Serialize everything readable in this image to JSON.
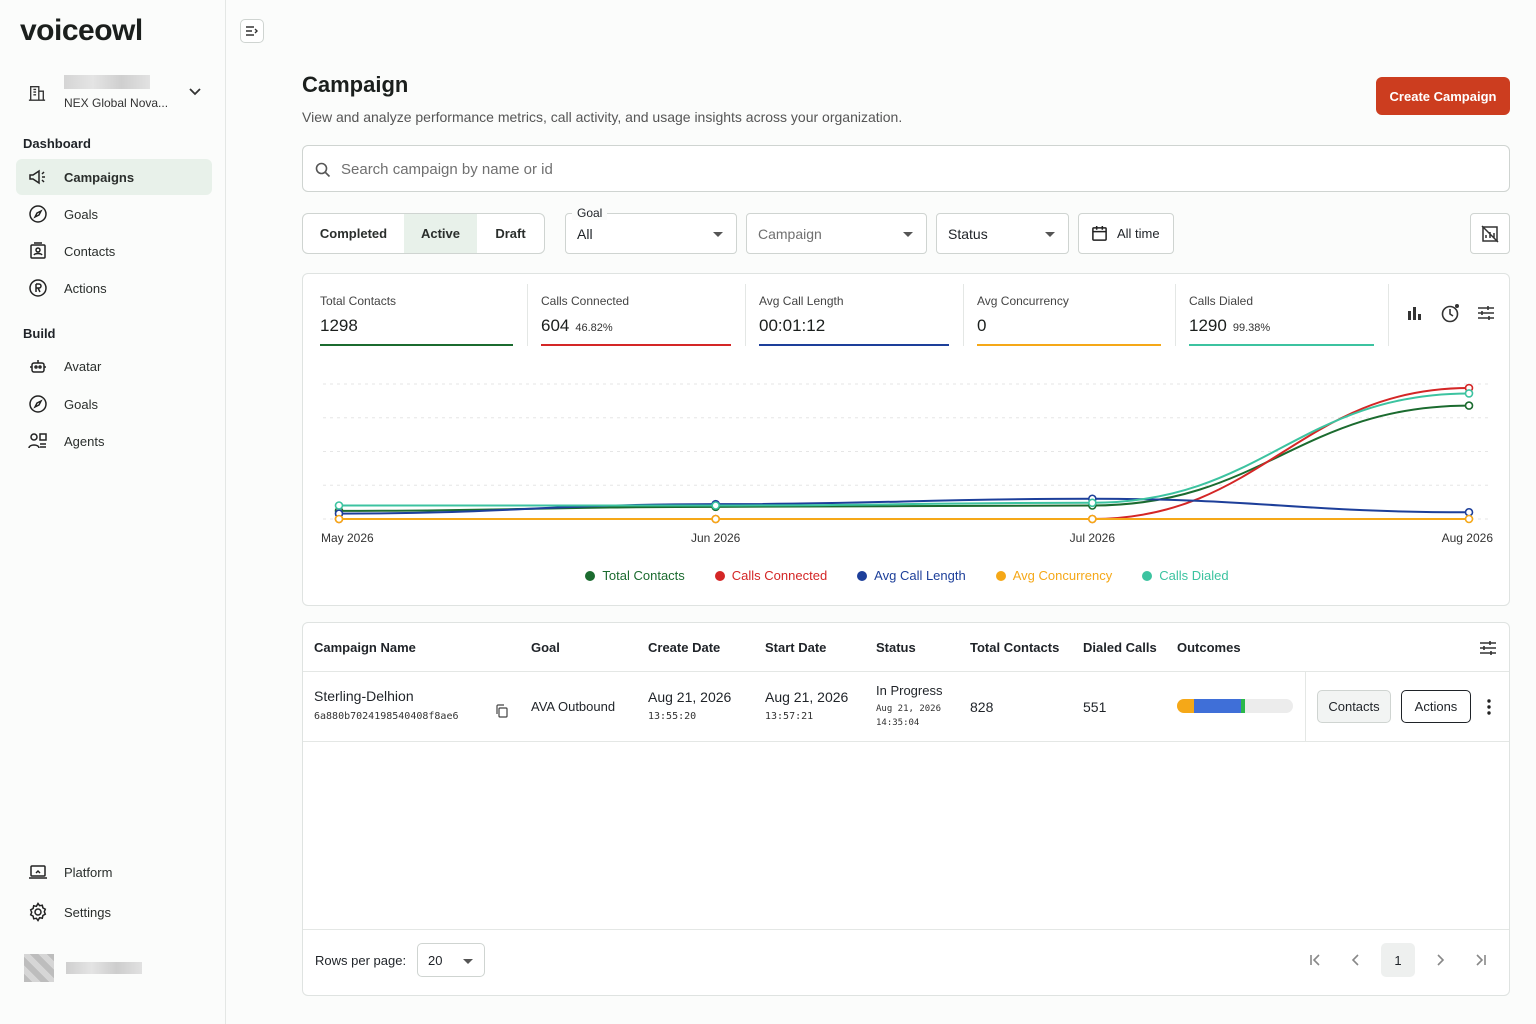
{
  "app": {
    "logo": "voiceowl"
  },
  "org": {
    "name": "NEX Global Nova..."
  },
  "sidebar": {
    "dashboard_title": "Dashboard",
    "dashboard_items": [
      {
        "label": "Campaigns",
        "icon": "megaphone-icon",
        "active": true
      },
      {
        "label": "Goals",
        "icon": "compass-icon"
      },
      {
        "label": "Contacts",
        "icon": "contacts-icon"
      },
      {
        "label": "Actions",
        "icon": "actions-icon"
      }
    ],
    "build_title": "Build",
    "build_items": [
      {
        "label": "Avatar",
        "icon": "robot-icon"
      },
      {
        "label": "Goals",
        "icon": "compass-icon"
      },
      {
        "label": "Agents",
        "icon": "agents-icon"
      }
    ],
    "bottom_items": [
      {
        "label": "Platform",
        "icon": "laptop-icon"
      },
      {
        "label": "Settings",
        "icon": "gear-icon"
      }
    ]
  },
  "header": {
    "title": "Campaign",
    "subtitle": "View and analyze performance metrics, call activity, and usage insights across your organization.",
    "create_label": "Create Campaign"
  },
  "search": {
    "placeholder": "Search campaign by name or id",
    "value": ""
  },
  "filters": {
    "segments": [
      "Completed",
      "Active",
      "Draft"
    ],
    "selected_segment": "Active",
    "goal": {
      "label": "Goal",
      "value": "All"
    },
    "campaign": {
      "placeholder": "Campaign"
    },
    "status": {
      "value": "Status"
    },
    "date": {
      "label": "All time"
    }
  },
  "metrics": [
    {
      "label": "Total Contacts",
      "value": "1298",
      "pct": "",
      "color": "#1b6b2f"
    },
    {
      "label": "Calls Connected",
      "value": "604",
      "pct": "46.82%",
      "color": "#d42626"
    },
    {
      "label": "Avg Call Length",
      "value": "00:01:12",
      "pct": "",
      "color": "#1d3f9a"
    },
    {
      "label": "Avg Concurrency",
      "value": "0",
      "pct": "",
      "color": "#f5a818"
    },
    {
      "label": "Calls Dialed",
      "value": "1290",
      "pct": "99.38%",
      "color": "#3cc3a0"
    }
  ],
  "chart_data": {
    "type": "line",
    "x": [
      "May 2026",
      "Jun 2026",
      "Jul 2026",
      "Aug 2026"
    ],
    "grid": "horizontal dashed",
    "legend_position": "bottom",
    "series": [
      {
        "name": "Total Contacts",
        "color": "#1b6b2f",
        "values": [
          0.06,
          0.09,
          0.1,
          0.84
        ]
      },
      {
        "name": "Calls Connected",
        "color": "#d42626",
        "values": [
          0,
          0,
          0,
          0.97
        ]
      },
      {
        "name": "Avg Call Length",
        "color": "#1d3f9a",
        "values": [
          0.04,
          0.11,
          0.15,
          0.05
        ]
      },
      {
        "name": "Avg Concurrency",
        "color": "#f5a818",
        "values": [
          0,
          0,
          0,
          0
        ]
      },
      {
        "name": "Calls Dialed",
        "color": "#3cc3a0",
        "values": [
          0.1,
          0.1,
          0.12,
          0.93
        ]
      }
    ]
  },
  "table": {
    "columns": [
      "Campaign Name",
      "Goal",
      "Create Date",
      "Start Date",
      "Status",
      "Total Contacts",
      "Dialed Calls",
      "Outcomes"
    ],
    "rows": [
      {
        "name": "Sterling-Delhion",
        "id": "6a880b7024198540408f8ae6",
        "goal": "AVA Outbound",
        "create_date": "Aug 21, 2026",
        "create_time": "13:55:20",
        "start_date": "Aug 21, 2026",
        "start_time": "13:57:21",
        "status": "In Progress",
        "status_date": "Aug 21, 2026",
        "status_time": "14:35:04",
        "total_contacts": "828",
        "dialed_calls": "551",
        "outcomes": [
          {
            "share": 0.15,
            "color": "#f5a818"
          },
          {
            "share": 0.4,
            "color": "#3f6fd8"
          },
          {
            "share": 0.04,
            "color": "#2bb84a"
          }
        ],
        "contacts_label": "Contacts",
        "actions_label": "Actions"
      }
    ]
  },
  "pagination": {
    "rows_label": "Rows per page:",
    "rows_value": "20",
    "current_page": "1"
  }
}
